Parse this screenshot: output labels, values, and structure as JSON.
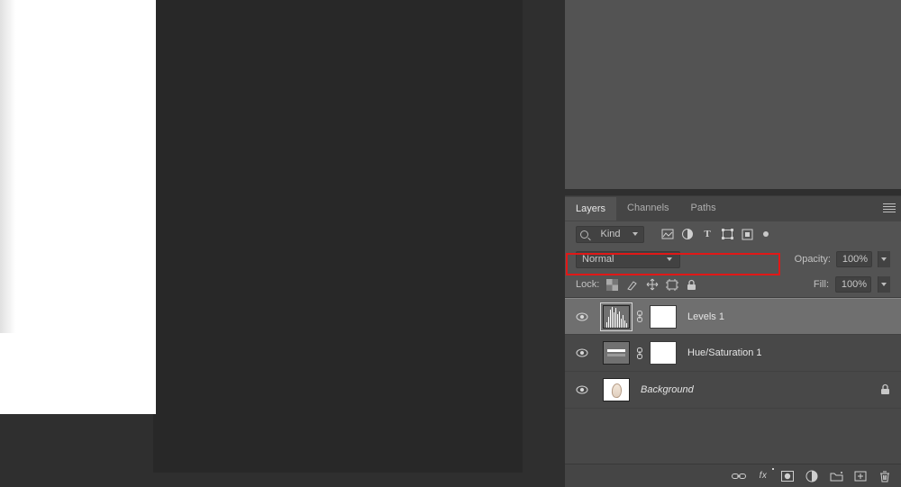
{
  "panel": {
    "tabs": {
      "layers": "Layers",
      "channels": "Channels",
      "paths": "Paths"
    },
    "filter": {
      "kind": "Kind"
    },
    "blend": {
      "mode": "Normal",
      "opacity_label": "Opacity:",
      "opacity_value": "100%"
    },
    "lock": {
      "label": "Lock:",
      "fill_label": "Fill:",
      "fill_value": "100%"
    }
  },
  "layers": [
    {
      "name": "Levels 1",
      "type": "levels",
      "selected": true
    },
    {
      "name": "Hue/Saturation 1",
      "type": "huesat",
      "selected": false
    },
    {
      "name": "Background",
      "type": "background",
      "selected": false
    }
  ]
}
